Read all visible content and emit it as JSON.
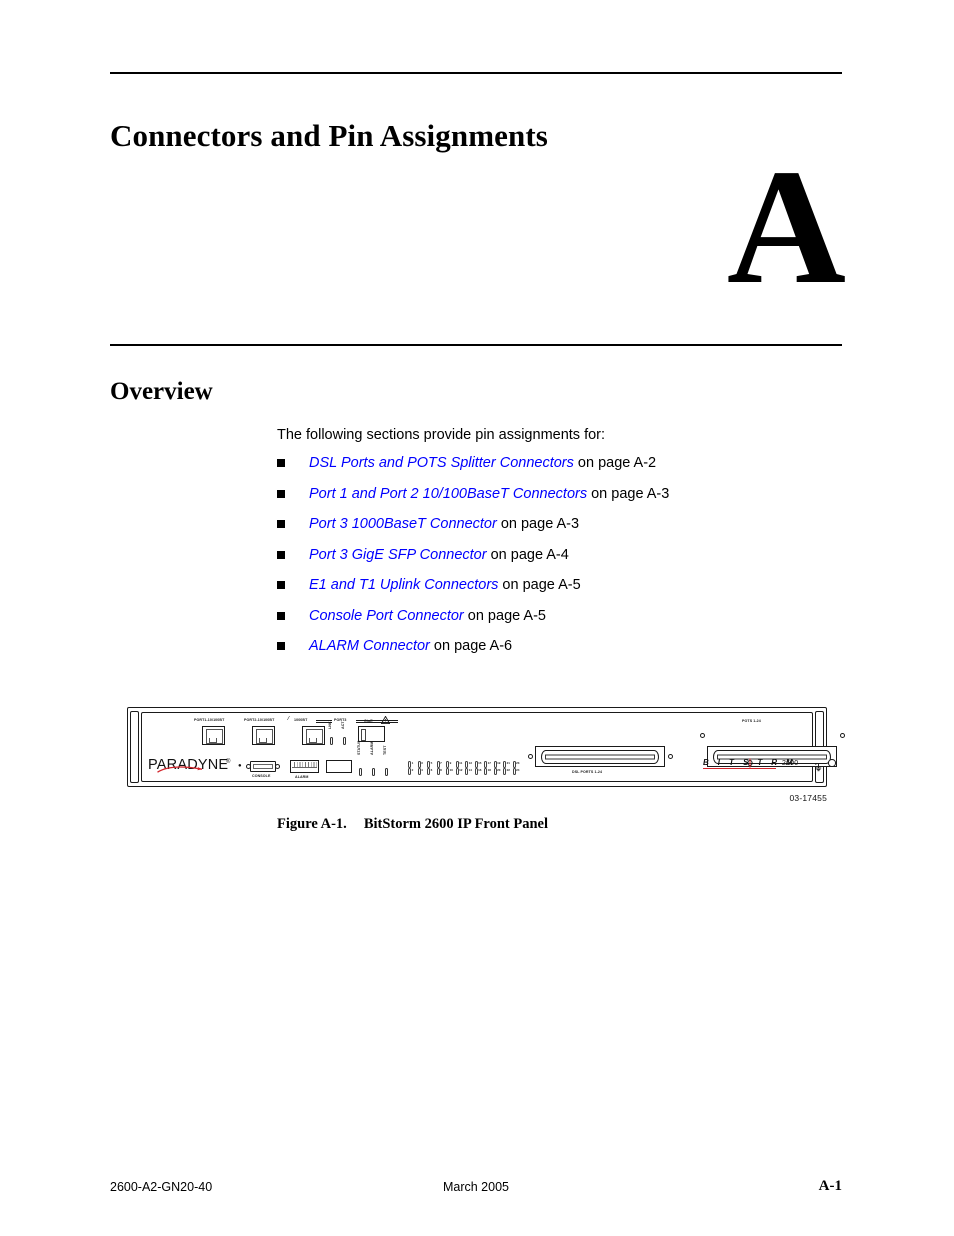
{
  "page": {
    "chapter_title": "Connectors and Pin Assignments",
    "chapter_letter": "A"
  },
  "overview": {
    "heading": "Overview",
    "intro": "The following sections provide pin assignments for:",
    "bullets": [
      {
        "link": "DSL Ports and POTS Splitter Connectors",
        "tail": " on page A-2"
      },
      {
        "link": "Port 1 and Port 2 10/100BaseT Connectors",
        "tail": " on page A-3"
      },
      {
        "link": "Port 3 1000BaseT Connector",
        "tail": " on page A-3"
      },
      {
        "link": "Port 3 GigE SFP Connector",
        "tail": " on page A-4"
      },
      {
        "link": "E1 and T1 Uplink Connectors",
        "tail": " on page A-5"
      },
      {
        "link": "Console Port Connector",
        "tail": " on page A-5"
      },
      {
        "link": "ALARM Connector",
        "tail": " on page A-6"
      }
    ],
    "link_color": "#0000ff"
  },
  "figure": {
    "caption_label": "Figure A-1.",
    "caption_text": "BitStorm 2600 IP Front Panel",
    "drawing_number": "03-17455",
    "panel": {
      "brand_logo": "PARADYNE",
      "brand_tm": "®",
      "product_letters": "B I T S T  R M",
      "product_model": "2600",
      "port_labels": {
        "port1": "PORT1-10/100BT",
        "port2": "PORT2-10/100BT",
        "port2_alt": "1000BT",
        "port3_group": "PORT3",
        "gige": "GigE"
      },
      "led_labels": {
        "lnk": "LNK",
        "act": "ACT",
        "status": "STATUS",
        "alarm": "ALARM",
        "test": "TEST"
      },
      "connector_labels": {
        "console": "CONSOLE",
        "alarm": "ALARM",
        "dsl_ports": "DSL PORTS 1-24",
        "pots": "POTS 1-24"
      },
      "dsl_led_numbers_top": [
        "1",
        "3",
        "5",
        "7",
        "9",
        "11",
        "13",
        "15",
        "17",
        "19",
        "21",
        "23"
      ],
      "dsl_led_numbers_bottom": [
        "2",
        "4",
        "6",
        "8",
        "10",
        "12",
        "14",
        "16",
        "18",
        "20",
        "22",
        "24"
      ],
      "accent_color": "#d2232a"
    }
  },
  "footer": {
    "doc_number": "2600-A2-GN20-40",
    "date": "March 2005",
    "page_number": "A-1"
  }
}
